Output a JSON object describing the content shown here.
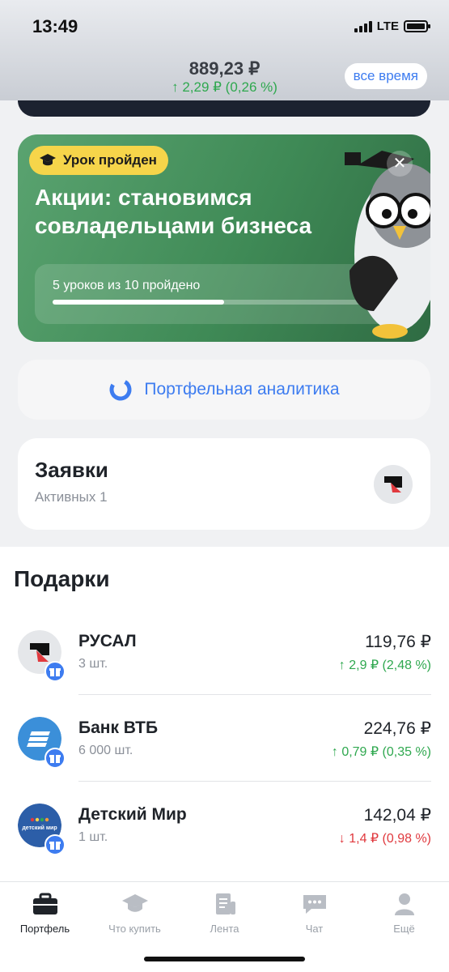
{
  "status_bar": {
    "time": "13:49",
    "network": "LTE"
  },
  "header": {
    "total_value": "889,23 ₽",
    "total_change": "2,29 ₽ (0,26 %)",
    "period_button": "все время"
  },
  "lesson_card": {
    "badge": "Урок пройден",
    "title": "Акции: становимся совладельцами бизнеса",
    "progress_text": "5 уроков из 10 пройдено",
    "progress_fraction": 0.5,
    "close_glyph": "✕"
  },
  "analytics": {
    "label": "Портфельная аналитика"
  },
  "orders": {
    "title": "Заявки",
    "subtitle": "Активных 1"
  },
  "gifts": {
    "title": "Подарки",
    "items": [
      {
        "name": "РУСАЛ",
        "qty": "3 шт.",
        "price": "119,76 ₽",
        "change": "2,9 ₽ (2,48 %)",
        "direction": "up",
        "logo": "rusal-logo"
      },
      {
        "name": "Банк ВТБ",
        "qty": "6 000 шт.",
        "price": "224,76 ₽",
        "change": "0,79 ₽ (0,35 %)",
        "direction": "up",
        "logo": "vtb-logo"
      },
      {
        "name": "Детский Мир",
        "qty": "1 шт.",
        "price": "142,04 ₽",
        "change": "1,4 ₽ (0,98 %)",
        "direction": "down",
        "logo": "detskiy-mir-logo",
        "logo_text": "детский мир"
      }
    ]
  },
  "tabbar": {
    "tabs": [
      {
        "label": "Портфель",
        "icon": "briefcase-icon",
        "active": true
      },
      {
        "label": "Что купить",
        "icon": "graduation-cap-icon",
        "active": false
      },
      {
        "label": "Лента",
        "icon": "news-icon",
        "active": false
      },
      {
        "label": "Чат",
        "icon": "chat-icon",
        "active": false
      },
      {
        "label": "Ещё",
        "icon": "profile-icon",
        "active": false
      }
    ]
  },
  "colors": {
    "accent": "#3d7cf0",
    "positive": "#2fa84f",
    "negative": "#e0393e",
    "lesson_green": "#4a9560",
    "badge_yellow": "#f6d54a"
  }
}
